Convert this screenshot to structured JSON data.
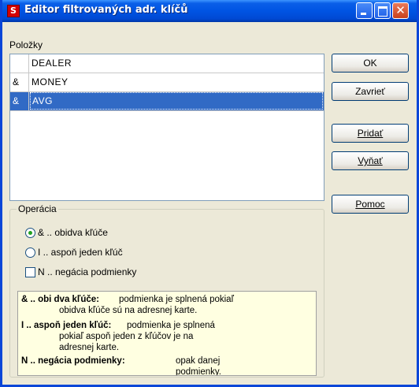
{
  "window": {
    "title": "Editor filtrovaných adr. klíčů",
    "icon": "S",
    "close_glyph": "✕"
  },
  "list": {
    "label": "Položky",
    "rows": [
      {
        "op": "",
        "key": "DEALER"
      },
      {
        "op": "&",
        "key": "MONEY"
      },
      {
        "op": "&",
        "key": "AVG"
      }
    ],
    "selected_index": 2
  },
  "buttons": {
    "ok": "OK",
    "zavriet": "Zavrieť",
    "pridat": "Pridať",
    "vynat": "Vyňať",
    "pomoc": "Pomoc"
  },
  "operation": {
    "title": "Operácia",
    "opt_and": "& .. obidva kľúče",
    "opt_or": "I .. aspoň jeden kľúč",
    "opt_not": "N .. negácia podmienky"
  },
  "help": {
    "and_title": "& .. obi dva kľúče:",
    "and_text1": "podmienka je splnená pokiaľ",
    "and_text2": "obidva kľúče sú na adresnej karte.",
    "or_title": "I .. aspoň jeden kľúč:",
    "or_text1": "podmienka je splnená",
    "or_text2": "pokiaľ aspoň jeden z kľúčov je na",
    "or_text3": "adresnej karte.",
    "not_title": "N .. negácia podmienky:",
    "not_text1": "opak danej",
    "not_text2": "podmienky."
  },
  "colors": {
    "titlebar": "#0054e3",
    "selection": "#316ac5",
    "help_bg": "#ffffe1"
  }
}
